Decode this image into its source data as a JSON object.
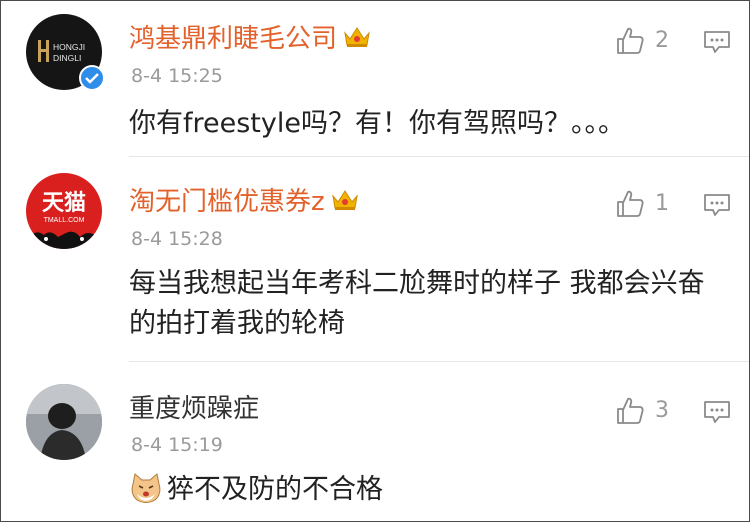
{
  "comments": [
    {
      "author": "鸿基鼎利睫毛公司",
      "avatar_text_1": "HONGJI",
      "avatar_text_2": "DINGLI",
      "time": "8-4 15:25",
      "text": "你有freestyle吗？有！你有驾照吗？。。。",
      "likes": "2",
      "verified": true,
      "crown": true
    },
    {
      "author": "淘无门槛优惠券z",
      "avatar_text_1": "天猫",
      "avatar_text_2": "TMALL.COM",
      "time": "8-4 15:28",
      "text": "每当我想起当年考科二尬舞时的样子 我都会兴奋的拍打着我的轮椅",
      "likes": "1",
      "verified": false,
      "crown": true
    },
    {
      "author": "重度烦躁症",
      "time": "8-4 15:19",
      "text": "猝不及防的不合格",
      "likes": "3",
      "verified": false,
      "crown": false
    }
  ],
  "colors": {
    "brand_name": "#e3612b",
    "meta": "#9a9a9a",
    "verified_badge": "#2d8de8",
    "crown": "#f0b400"
  },
  "icons": [
    "thumbs-up-icon",
    "reply-icon",
    "crown-icon",
    "verified-icon",
    "cat-emoji-icon"
  ]
}
